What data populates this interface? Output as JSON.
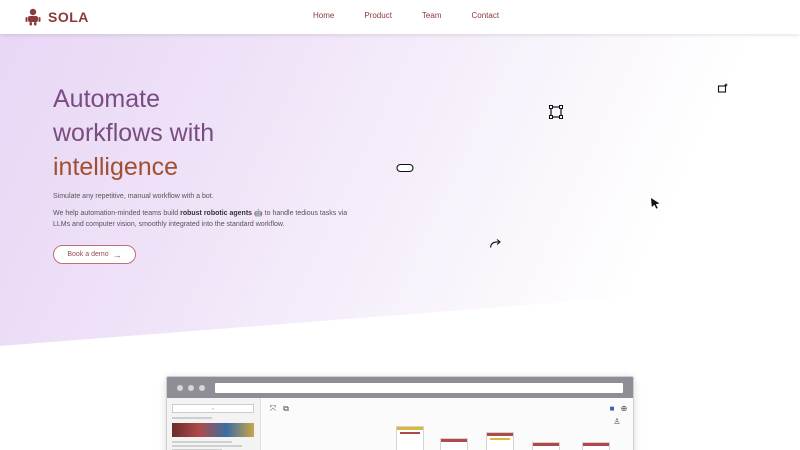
{
  "brand": {
    "name": "SOLA"
  },
  "nav": {
    "items": [
      "Home",
      "Product",
      "Team",
      "Contact"
    ]
  },
  "hero": {
    "headline_line1": "Automate",
    "headline_line2": "workflows with",
    "headline_line3": "intelligence",
    "subheading": "Simulate any repetitive, manual workflow with a bot.",
    "desc_part1": "We help automation-minded teams build ",
    "desc_bold": "robust robotic agents",
    "desc_part2": " 🤖 to handle tedious tasks via LLMs and computer vision, smoothly integrated into the standard workflow.",
    "cta_label": "Book a demo",
    "cta_arrow": "→"
  },
  "preview": {
    "search_placeholder": "⌕"
  },
  "colors": {
    "brand": "#8a3a3a",
    "headline": "#7a4d82",
    "headline_accent": "#a05030",
    "hero_gradient_start": "#e8d6f5"
  },
  "icons": [
    "robot-logo-icon",
    "crop-frame-icon",
    "magic-wand-icon",
    "pill-shape-icon",
    "cursor-arrow-icon",
    "redo-arrow-icon"
  ]
}
